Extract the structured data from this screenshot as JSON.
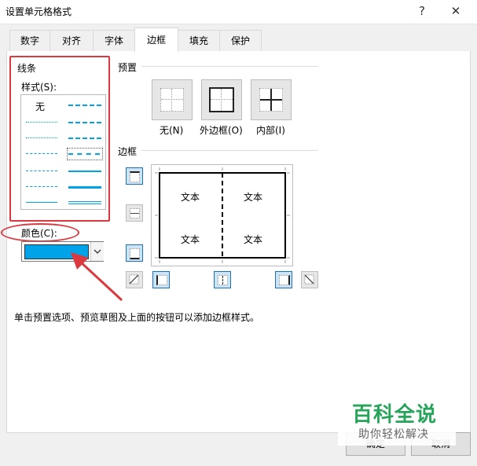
{
  "window": {
    "title": "设置单元格格式",
    "help": "?",
    "close": "✕"
  },
  "tabs": [
    "数字",
    "对齐",
    "字体",
    "边框",
    "填充",
    "保护"
  ],
  "line_section": {
    "heading": "线条",
    "style_label": "样式(S):",
    "none_label": "无",
    "color_label": "颜色(C):",
    "color_value": "#00a2e8"
  },
  "presets": {
    "heading": "预置",
    "items": [
      "无(N)",
      "外边框(O)",
      "内部(I)"
    ]
  },
  "border": {
    "heading": "边框",
    "cells": [
      "文本",
      "文本",
      "文本",
      "文本"
    ]
  },
  "hint": "单击预置选项、预览草图及上面的按钮可以添加边框样式。",
  "buttons": {
    "ok": "确定",
    "cancel": "取消"
  },
  "watermark": {
    "title": "百科全说",
    "subtitle": "助你轻松解决"
  }
}
